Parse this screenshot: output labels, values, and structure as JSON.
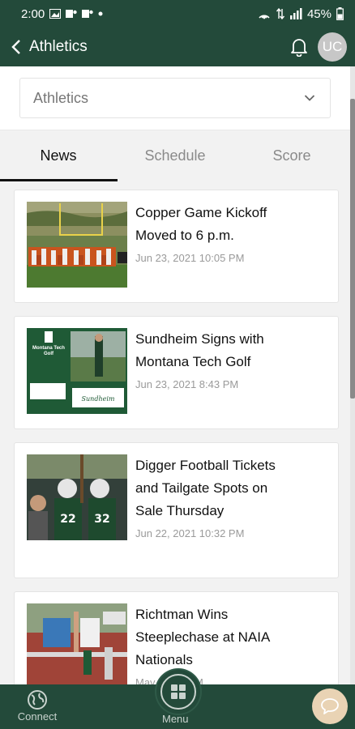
{
  "status_bar": {
    "time": "2:00",
    "battery": "45%"
  },
  "header": {
    "title": "Athletics",
    "avatar_initials": "UC"
  },
  "dropdown": {
    "selected": "Athletics"
  },
  "tabs": [
    {
      "label": "News",
      "active": true
    },
    {
      "label": "Schedule",
      "active": false
    },
    {
      "label": "Score",
      "active": false
    }
  ],
  "news": [
    {
      "title_line1": "Copper Game Kickoff",
      "title_line2": "Moved to 6 p.m.",
      "title_line3": "",
      "date": "Jun 23, 2021 10:05 PM"
    },
    {
      "title_line1": "Sundheim Signs with",
      "title_line2": "Montana Tech Golf",
      "title_line3": "",
      "date": "Jun 23, 2021 8:43 PM",
      "thumb_text": "Montana Tech Golf"
    },
    {
      "title_line1": "Digger Football Tickets",
      "title_line2": "and Tailgate Spots on",
      "title_line3": "Sale Thursday",
      "date": "Jun 22, 2021 10:32 PM"
    },
    {
      "title_line1": "Richtman Wins",
      "title_line2": "Steeplechase at NAIA",
      "title_line3": "Nationals",
      "date": "May 17:40 PM"
    }
  ],
  "bottom_nav": {
    "connect_label": "Connect",
    "menu_label": "Menu"
  },
  "colors": {
    "brand": "#234a3a",
    "chat": "#e9d3b4"
  }
}
